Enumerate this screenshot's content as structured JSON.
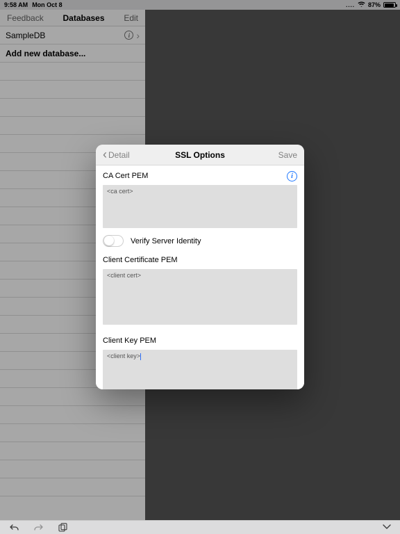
{
  "statusbar": {
    "time": "9:58 AM",
    "date": "Mon Oct 8",
    "battery_pct": "87%",
    "wifi_glyph": "✦"
  },
  "left_nav": {
    "feedback_label": "Feedback",
    "title": "Databases",
    "edit_label": "Edit"
  },
  "list": {
    "item1_name": "SampleDB",
    "add_label": "Add new database..."
  },
  "modal": {
    "back_label": "Detail",
    "title": "SSL Options",
    "save_label": "Save",
    "ca_cert_label": "CA Cert PEM",
    "ca_cert_value": "<ca cert>",
    "verify_label": "Verify Server Identity",
    "client_cert_label": "Client Certificate PEM",
    "client_cert_value": "<client cert>",
    "client_key_label": "Client Key PEM",
    "client_key_value": "<client key>"
  }
}
